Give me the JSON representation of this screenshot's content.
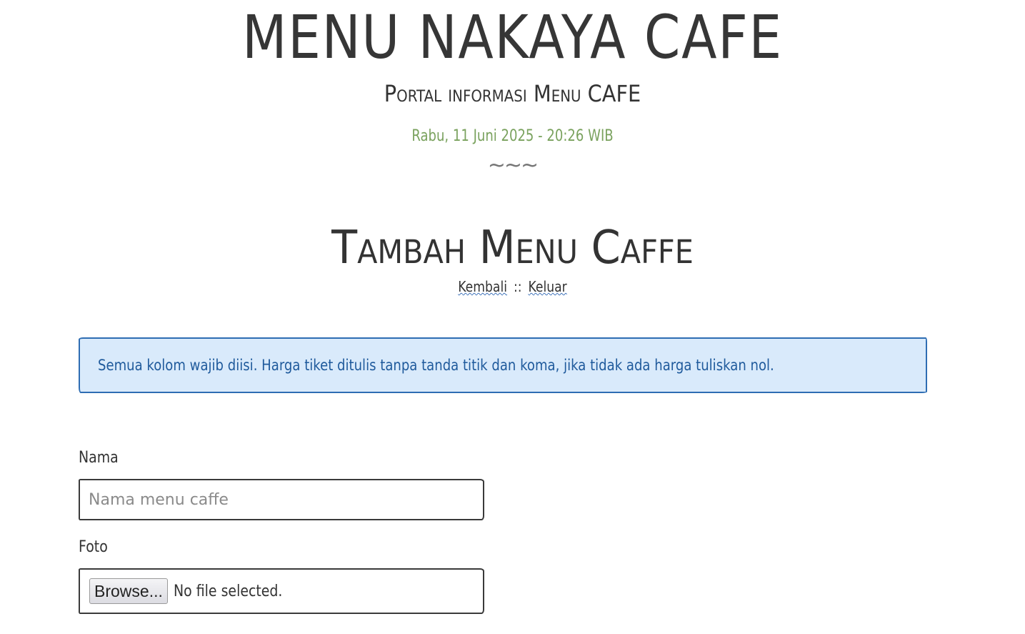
{
  "header": {
    "title": "MENU NAKAYA CAFE",
    "subtitle": "Portal informasi Menu CAFE",
    "datetime": "Rabu, 11 Juni 2025 - 20:26 WIB",
    "divider": "~~~"
  },
  "page": {
    "title": "Tambah Menu Caffe",
    "nav": {
      "back_label": "Kembali",
      "separator": "::",
      "logout_label": "Keluar"
    }
  },
  "alert": {
    "message": "Semua kolom wajib diisi. Harga tiket ditulis tanpa tanda titik dan koma, jika tidak ada harga tuliskan nol."
  },
  "form": {
    "nama": {
      "label": "Nama",
      "placeholder": "Nama menu caffe",
      "value": ""
    },
    "foto": {
      "label": "Foto",
      "browse_label": "Browse...",
      "status": "No file selected."
    }
  },
  "colors": {
    "datetime": "#7aa25e",
    "alert_background": "#d9eafb",
    "alert_border": "#2e6db3",
    "alert_text": "#1f5a9c"
  }
}
